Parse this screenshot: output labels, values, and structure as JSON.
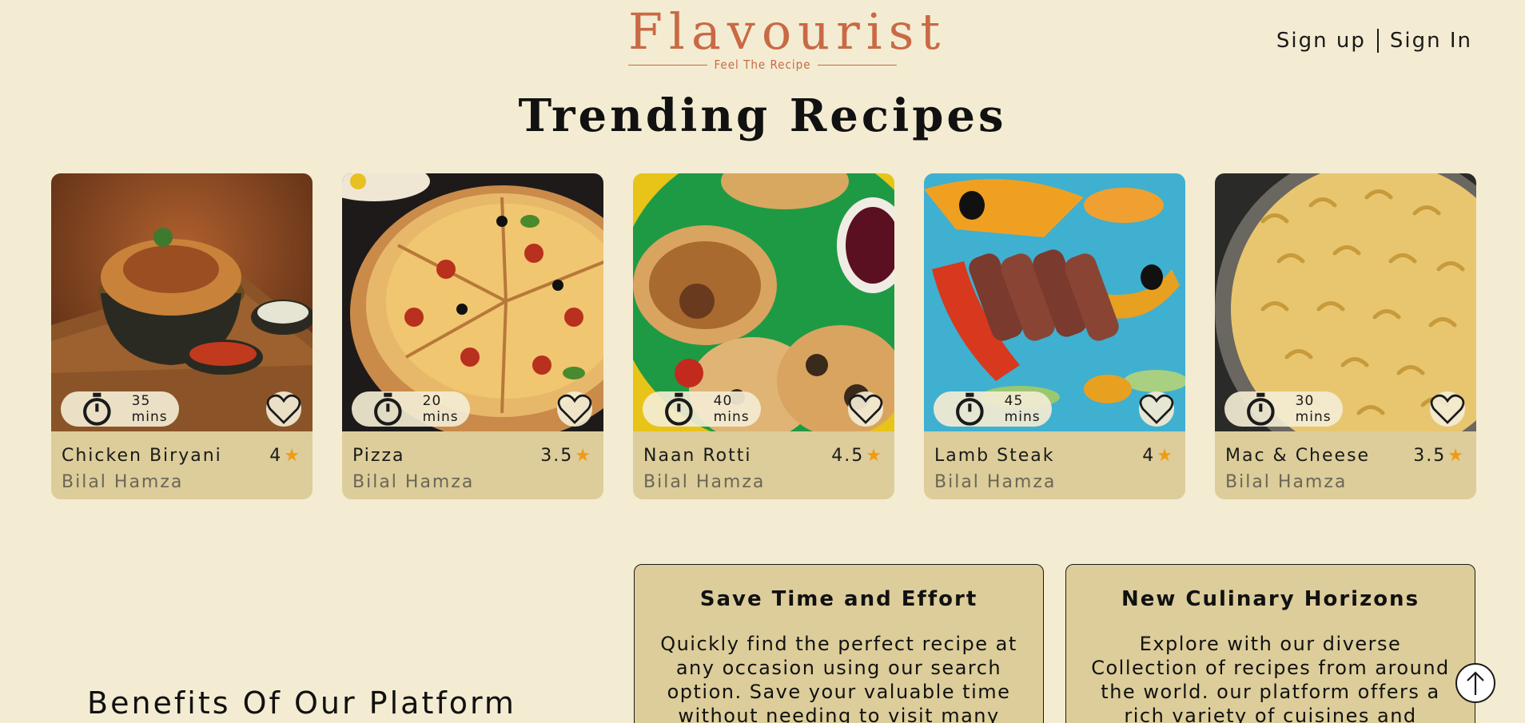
{
  "header": {
    "logo_title": "Flavourist",
    "logo_tagline": "Feel The Recipe",
    "sign_up": "Sign up",
    "sign_in": "Sign In"
  },
  "trending": {
    "title": "Trending Recipes",
    "cards": [
      {
        "name": "Chicken Biryani",
        "rating": "4",
        "author": "Bilal Hamza",
        "time": "35 mins",
        "image": "chicken biryani photo"
      },
      {
        "name": "Pizza",
        "rating": "3.5",
        "author": "Bilal Hamza",
        "time": "20 mins",
        "image": "pepperoni pizza photo"
      },
      {
        "name": "Naan Rotti",
        "rating": "4.5",
        "author": "Bilal Hamza",
        "time": "40 mins",
        "image": "baked pastries photo"
      },
      {
        "name": "Lamb Steak",
        "rating": "4",
        "author": "Bilal Hamza",
        "time": "45 mins",
        "image": "lamb steak salad photo"
      },
      {
        "name": "Mac & Cheese",
        "rating": "3.5",
        "author": "Bilal Hamza",
        "time": "30 mins",
        "image": "mac and cheese photo"
      }
    ]
  },
  "benefits": {
    "title": "Benefits Of Our Platform",
    "items": [
      {
        "heading": "Save Time and Effort",
        "text": "Quickly find the perfect recipe at any occasion using our search option. Save your valuable time without needing to visit many"
      },
      {
        "heading": "New Culinary Horizons",
        "text": "Explore with our diverse Collection of recipes from around the world. our platform offers a rich variety of cuisines and"
      }
    ]
  },
  "icons": {
    "timer": "timer-icon",
    "favorite": "heart-icon",
    "rating": "star-icon",
    "scroll_top": "arrow-up-icon"
  },
  "colors": {
    "background": "#f3ecd2",
    "card": "#dccd9a",
    "brand": "#c96a45",
    "star": "#f29a12"
  }
}
